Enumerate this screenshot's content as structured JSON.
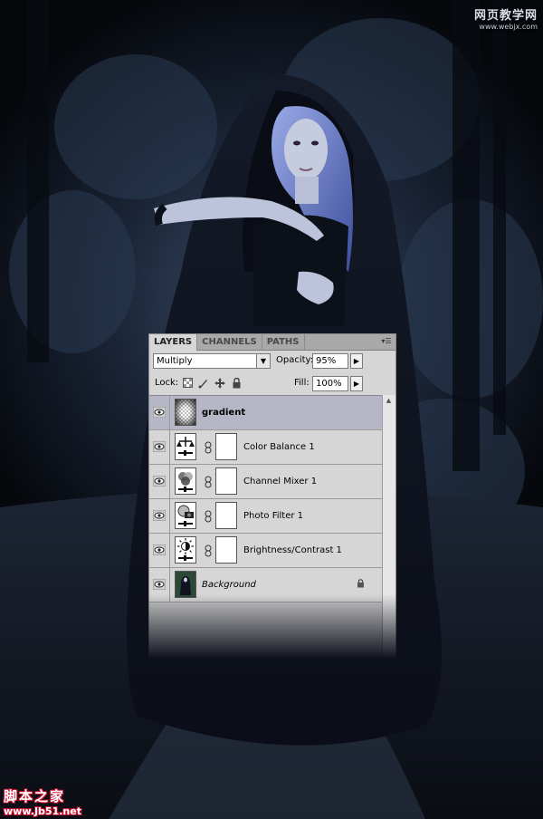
{
  "watermark_top": {
    "chinese": "网页教学网",
    "url": "www.webjx.com"
  },
  "watermark_bottom": {
    "chinese": "脚本之家",
    "url": "www.Jb51.net"
  },
  "layers_panel": {
    "tabs": [
      {
        "label": "LAYERS",
        "active": true
      },
      {
        "label": "CHANNELS",
        "active": false
      },
      {
        "label": "PATHS",
        "active": false
      }
    ],
    "menu_icon": "panel-menu-icon",
    "blend_mode": "Multiply",
    "opacity_label": "Opacity:",
    "opacity_value": "95%",
    "lock_label": "Lock:",
    "fill_label": "Fill:",
    "fill_value": "100%",
    "layers": [
      {
        "name": "gradient",
        "selected": true,
        "icon": "gradient-thumb",
        "visible": true
      },
      {
        "name": "Color Balance 1",
        "selected": false,
        "icon": "color-balance-icon",
        "visible": true
      },
      {
        "name": "Channel Mixer 1",
        "selected": false,
        "icon": "channel-mixer-icon",
        "visible": true
      },
      {
        "name": "Photo Filter 1",
        "selected": false,
        "icon": "photo-filter-icon",
        "visible": true
      },
      {
        "name": "Brightness/Contrast 1",
        "selected": false,
        "icon": "brightness-contrast-icon",
        "visible": true
      },
      {
        "name": "Background",
        "selected": false,
        "icon": "background-thumb",
        "visible": true,
        "locked": true
      }
    ]
  },
  "colors": {
    "panel_bg": "#d6d6d6",
    "selected_row": "#b5b6c6",
    "scene_dark": "#0e1420",
    "hair_blue": "#6e86d6"
  }
}
